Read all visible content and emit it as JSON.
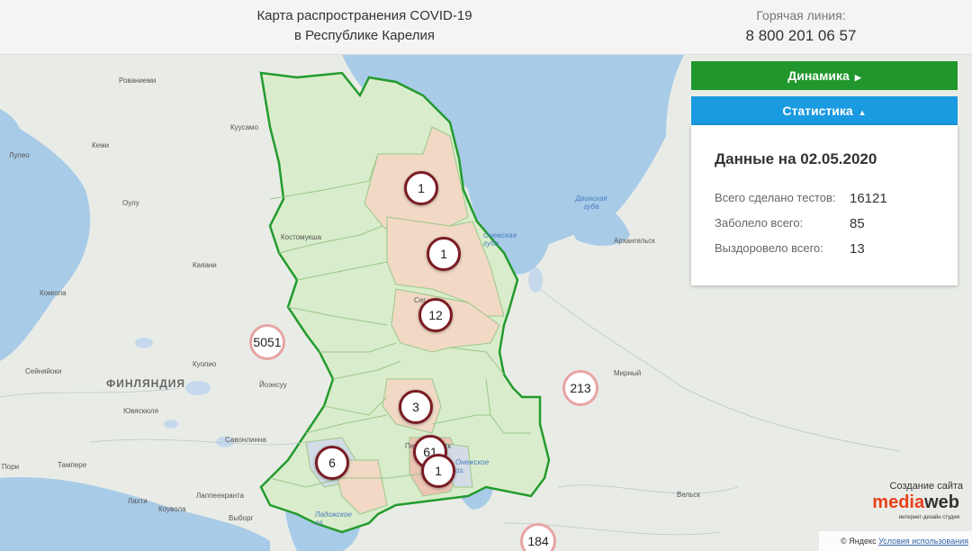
{
  "header": {
    "title_line1": "Карта распространения COVID-19",
    "title_line2": "в Республике Карелия",
    "hotline_label": "Горячая линия:",
    "hotline_phone": "8 800 201 06 57"
  },
  "buttons": {
    "dynamics": "Динамика",
    "statistics": "Статистика"
  },
  "stats": {
    "date_label": "Данные на 02.05.2020",
    "rows": [
      {
        "label": "Всего сделано тестов:",
        "value": "16121"
      },
      {
        "label": "Заболело всего:",
        "value": "85"
      },
      {
        "label": "Выздоровело всего:",
        "value": "13"
      }
    ]
  },
  "markers": [
    "1",
    "1",
    "12",
    "3",
    "61",
    "1",
    "6"
  ],
  "clusters": [
    "5051",
    "213",
    "184"
  ],
  "map_labels": {
    "rovaniemi": "Рованиеми",
    "kuusamo": "Куусамо",
    "kemi": "Кеми",
    "lulea": "Лулео",
    "oulu": "Оулу",
    "kostomuksha": "Костомукша",
    "kajaani": "Каяани",
    "kokkola": "Коккола",
    "seinajoki": "Сейняйоки",
    "kuopio": "Куопио",
    "joensuu": "Йоэнсуу",
    "finland": "ФИНЛЯНДИЯ",
    "jyvaskyla": "Ювяскюля",
    "savonlinna": "Савонлинна",
    "tampere": "Тампере",
    "pori": "Пори",
    "lahti": "Лахти",
    "kouvola": "Коувола",
    "lappeenranta": "Лаппеенранта",
    "vyborg": "Выборг",
    "dvina_bay": "Двинская губа",
    "onega_bay": "Онежская губа",
    "arkhangelsk": "Архангельск",
    "mirny": "Мирный",
    "petrozavodsk": "Петрозаводск",
    "onega_lake": "Онежское оз.",
    "ladoga": "Ладожское оз.",
    "velsk": "Вельск",
    "segezha": "Сег"
  },
  "promo": {
    "caption": "Создание сайта",
    "logo_a": "media",
    "logo_b": "web",
    "sub": "интернет-дизайн студия"
  },
  "copyright": {
    "text": "© Яндекс",
    "link": "Условия использования"
  }
}
